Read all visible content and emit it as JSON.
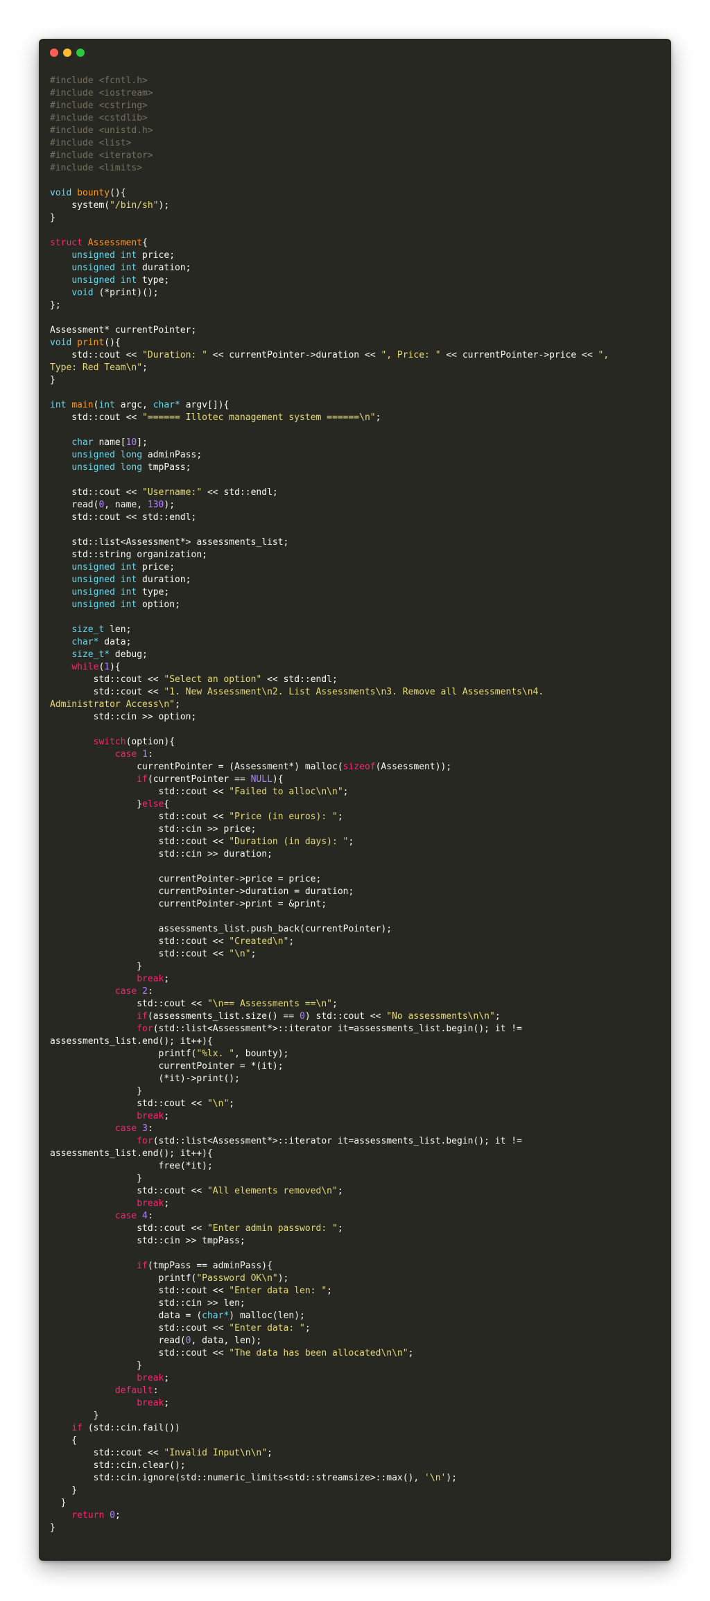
{
  "window": {
    "controls": [
      {
        "name": "close",
        "color": "#ff5f56"
      },
      {
        "name": "minimize",
        "color": "#ffbd2e"
      },
      {
        "name": "maximize",
        "color": "#27c93f"
      }
    ]
  },
  "theme": {
    "background": "#272822",
    "text": "#f8f8f2",
    "comment": "#75715e",
    "keyword": "#f92672",
    "type": "#66d9ef",
    "string": "#e6db74",
    "number": "#ae81ff",
    "name": "#fd971f"
  },
  "code_lines": [
    [
      {
        "t": "#include <fcntl.h>",
        "c": "cm"
      }
    ],
    [
      {
        "t": "#include <iostream>",
        "c": "cm"
      }
    ],
    [
      {
        "t": "#include <cstring>",
        "c": "cm"
      }
    ],
    [
      {
        "t": "#include <cstdlib>",
        "c": "cm"
      }
    ],
    [
      {
        "t": "#include <unistd.h>",
        "c": "cm"
      }
    ],
    [
      {
        "t": "#include <list>",
        "c": "cm"
      }
    ],
    [
      {
        "t": "#include <iterator>",
        "c": "cm"
      }
    ],
    [
      {
        "t": "#include <limits>",
        "c": "cm"
      }
    ],
    [],
    [
      {
        "t": "void",
        "c": "ty"
      },
      {
        "t": " "
      },
      {
        "t": "bounty",
        "c": "df"
      },
      {
        "t": "(){"
      }
    ],
    [
      {
        "t": "    system("
      },
      {
        "t": "\"/bin/sh\"",
        "c": "st"
      },
      {
        "t": ");"
      }
    ],
    [
      {
        "t": "}"
      }
    ],
    [],
    [
      {
        "t": "struct",
        "c": "kw"
      },
      {
        "t": " "
      },
      {
        "t": "Assessment",
        "c": "cl"
      },
      {
        "t": "{"
      }
    ],
    [
      {
        "t": "    "
      },
      {
        "t": "unsigned int",
        "c": "ty"
      },
      {
        "t": " price;"
      }
    ],
    [
      {
        "t": "    "
      },
      {
        "t": "unsigned int",
        "c": "ty"
      },
      {
        "t": " duration;"
      }
    ],
    [
      {
        "t": "    "
      },
      {
        "t": "unsigned int",
        "c": "ty"
      },
      {
        "t": " type;"
      }
    ],
    [
      {
        "t": "    "
      },
      {
        "t": "void",
        "c": "ty"
      },
      {
        "t": " (*print)();"
      }
    ],
    [
      {
        "t": "};"
      }
    ],
    [],
    [
      {
        "t": "Assessment* currentPointer;"
      }
    ],
    [
      {
        "t": "void",
        "c": "ty"
      },
      {
        "t": " "
      },
      {
        "t": "print",
        "c": "df"
      },
      {
        "t": "(){"
      }
    ],
    [
      {
        "t": "    std::cout << "
      },
      {
        "t": "\"Duration: \"",
        "c": "st"
      },
      {
        "t": " << currentPointer->duration << "
      },
      {
        "t": "\", Price: \"",
        "c": "st"
      },
      {
        "t": " << currentPointer->price << "
      },
      {
        "t": "\",",
        "c": "st"
      }
    ],
    [
      {
        "t": "Type: Red Team\\n\"",
        "c": "st"
      },
      {
        "t": ";"
      }
    ],
    [
      {
        "t": "}"
      }
    ],
    [],
    [
      {
        "t": "int",
        "c": "ty"
      },
      {
        "t": " "
      },
      {
        "t": "main",
        "c": "df"
      },
      {
        "t": "("
      },
      {
        "t": "int",
        "c": "ty"
      },
      {
        "t": " argc, "
      },
      {
        "t": "char*",
        "c": "ty"
      },
      {
        "t": " argv[]){"
      }
    ],
    [
      {
        "t": "    std::cout << "
      },
      {
        "t": "\"====== Illotec management system ======\\n\"",
        "c": "st"
      },
      {
        "t": ";"
      }
    ],
    [],
    [
      {
        "t": "    "
      },
      {
        "t": "char",
        "c": "ty"
      },
      {
        "t": " name["
      },
      {
        "t": "10",
        "c": "nu"
      },
      {
        "t": "];"
      }
    ],
    [
      {
        "t": "    "
      },
      {
        "t": "unsigned long",
        "c": "ty"
      },
      {
        "t": " adminPass;"
      }
    ],
    [
      {
        "t": "    "
      },
      {
        "t": "unsigned long",
        "c": "ty"
      },
      {
        "t": " tmpPass;"
      }
    ],
    [],
    [
      {
        "t": "    std::cout << "
      },
      {
        "t": "\"Username:\"",
        "c": "st"
      },
      {
        "t": " << std::endl;"
      }
    ],
    [
      {
        "t": "    read("
      },
      {
        "t": "0",
        "c": "nu"
      },
      {
        "t": ", name, "
      },
      {
        "t": "130",
        "c": "nu"
      },
      {
        "t": ");"
      }
    ],
    [
      {
        "t": "    std::cout << std::endl;"
      }
    ],
    [],
    [
      {
        "t": "    std::list<Assessment*> assessments_list;"
      }
    ],
    [
      {
        "t": "    std::string organization;"
      }
    ],
    [
      {
        "t": "    "
      },
      {
        "t": "unsigned int",
        "c": "ty"
      },
      {
        "t": " price;"
      }
    ],
    [
      {
        "t": "    "
      },
      {
        "t": "unsigned int",
        "c": "ty"
      },
      {
        "t": " duration;"
      }
    ],
    [
      {
        "t": "    "
      },
      {
        "t": "unsigned int",
        "c": "ty"
      },
      {
        "t": " type;"
      }
    ],
    [
      {
        "t": "    "
      },
      {
        "t": "unsigned int",
        "c": "ty"
      },
      {
        "t": " option;"
      }
    ],
    [],
    [
      {
        "t": "    "
      },
      {
        "t": "size_t",
        "c": "ty"
      },
      {
        "t": " len;"
      }
    ],
    [
      {
        "t": "    "
      },
      {
        "t": "char*",
        "c": "ty"
      },
      {
        "t": " data;"
      }
    ],
    [
      {
        "t": "    "
      },
      {
        "t": "size_t*",
        "c": "ty"
      },
      {
        "t": " debug;"
      }
    ],
    [
      {
        "t": "    "
      },
      {
        "t": "while",
        "c": "kw"
      },
      {
        "t": "("
      },
      {
        "t": "1",
        "c": "nu"
      },
      {
        "t": "){"
      }
    ],
    [
      {
        "t": "        std::cout << "
      },
      {
        "t": "\"Select an option\"",
        "c": "st"
      },
      {
        "t": " << std::endl;"
      }
    ],
    [
      {
        "t": "        std::cout << "
      },
      {
        "t": "\"1. New Assessment\\n2. List Assessments\\n3. Remove all Assessments\\n4.",
        "c": "st"
      }
    ],
    [
      {
        "t": "Administrator Access\\n\"",
        "c": "st"
      },
      {
        "t": ";"
      }
    ],
    [
      {
        "t": "        std::cin >> option;"
      }
    ],
    [],
    [
      {
        "t": "        "
      },
      {
        "t": "switch",
        "c": "kw"
      },
      {
        "t": "(option){"
      }
    ],
    [
      {
        "t": "            "
      },
      {
        "t": "case",
        "c": "kw"
      },
      {
        "t": " "
      },
      {
        "t": "1",
        "c": "nu"
      },
      {
        "t": ":"
      }
    ],
    [
      {
        "t": "                currentPointer = (Assessment*) malloc("
      },
      {
        "t": "sizeof",
        "c": "kw"
      },
      {
        "t": "(Assessment));"
      }
    ],
    [
      {
        "t": "                "
      },
      {
        "t": "if",
        "c": "kw"
      },
      {
        "t": "(currentPointer == "
      },
      {
        "t": "NULL",
        "c": "nu"
      },
      {
        "t": "){"
      }
    ],
    [
      {
        "t": "                    std::cout << "
      },
      {
        "t": "\"Failed to alloc\\n\\n\"",
        "c": "st"
      },
      {
        "t": ";"
      }
    ],
    [
      {
        "t": "                }"
      },
      {
        "t": "else",
        "c": "kw"
      },
      {
        "t": "{"
      }
    ],
    [
      {
        "t": "                    std::cout << "
      },
      {
        "t": "\"Price (in euros): \"",
        "c": "st"
      },
      {
        "t": ";"
      }
    ],
    [
      {
        "t": "                    std::cin >> price;"
      }
    ],
    [
      {
        "t": "                    std::cout << "
      },
      {
        "t": "\"Duration (in days): \"",
        "c": "st"
      },
      {
        "t": ";"
      }
    ],
    [
      {
        "t": "                    std::cin >> duration;"
      }
    ],
    [],
    [
      {
        "t": "                    currentPointer->price = price;"
      }
    ],
    [
      {
        "t": "                    currentPointer->duration = duration;"
      }
    ],
    [
      {
        "t": "                    currentPointer->print = &print;"
      }
    ],
    [],
    [
      {
        "t": "                    assessments_list.push_back(currentPointer);"
      }
    ],
    [
      {
        "t": "                    std::cout << "
      },
      {
        "t": "\"Created\\n\"",
        "c": "st"
      },
      {
        "t": ";"
      }
    ],
    [
      {
        "t": "                    std::cout << "
      },
      {
        "t": "\"\\n\"",
        "c": "st"
      },
      {
        "t": ";"
      }
    ],
    [
      {
        "t": "                }"
      }
    ],
    [
      {
        "t": "                "
      },
      {
        "t": "break",
        "c": "kw"
      },
      {
        "t": ";"
      }
    ],
    [
      {
        "t": "            "
      },
      {
        "t": "case",
        "c": "kw"
      },
      {
        "t": " "
      },
      {
        "t": "2",
        "c": "nu"
      },
      {
        "t": ":"
      }
    ],
    [
      {
        "t": "                std::cout << "
      },
      {
        "t": "\"\\n== Assessments ==\\n\"",
        "c": "st"
      },
      {
        "t": ";"
      }
    ],
    [
      {
        "t": "                "
      },
      {
        "t": "if",
        "c": "kw"
      },
      {
        "t": "(assessments_list.size() == "
      },
      {
        "t": "0",
        "c": "nu"
      },
      {
        "t": ") std::cout << "
      },
      {
        "t": "\"No assessments\\n\\n\"",
        "c": "st"
      },
      {
        "t": ";"
      }
    ],
    [
      {
        "t": "                "
      },
      {
        "t": "for",
        "c": "kw"
      },
      {
        "t": "(std::list<Assessment*>::iterator it=assessments_list.begin(); it !="
      }
    ],
    [
      {
        "t": "assessments_list.end(); it++){"
      }
    ],
    [
      {
        "t": "                    printf("
      },
      {
        "t": "\"%lx. \"",
        "c": "st"
      },
      {
        "t": ", bounty);"
      }
    ],
    [
      {
        "t": "                    currentPointer = *(it);"
      }
    ],
    [
      {
        "t": "                    (*it)->print();"
      }
    ],
    [
      {
        "t": "                }"
      }
    ],
    [
      {
        "t": "                std::cout << "
      },
      {
        "t": "\"\\n\"",
        "c": "st"
      },
      {
        "t": ";"
      }
    ],
    [
      {
        "t": "                "
      },
      {
        "t": "break",
        "c": "kw"
      },
      {
        "t": ";"
      }
    ],
    [
      {
        "t": "            "
      },
      {
        "t": "case",
        "c": "kw"
      },
      {
        "t": " "
      },
      {
        "t": "3",
        "c": "nu"
      },
      {
        "t": ":"
      }
    ],
    [
      {
        "t": "                "
      },
      {
        "t": "for",
        "c": "kw"
      },
      {
        "t": "(std::list<Assessment*>::iterator it=assessments_list.begin(); it !="
      }
    ],
    [
      {
        "t": "assessments_list.end(); it++){"
      }
    ],
    [
      {
        "t": "                    free(*it);"
      }
    ],
    [
      {
        "t": "                }"
      }
    ],
    [
      {
        "t": "                std::cout << "
      },
      {
        "t": "\"All elements removed\\n\"",
        "c": "st"
      },
      {
        "t": ";"
      }
    ],
    [
      {
        "t": "                "
      },
      {
        "t": "break",
        "c": "kw"
      },
      {
        "t": ";"
      }
    ],
    [
      {
        "t": "            "
      },
      {
        "t": "case",
        "c": "kw"
      },
      {
        "t": " "
      },
      {
        "t": "4",
        "c": "nu"
      },
      {
        "t": ":"
      }
    ],
    [
      {
        "t": "                std::cout << "
      },
      {
        "t": "\"Enter admin password: \"",
        "c": "st"
      },
      {
        "t": ";"
      }
    ],
    [
      {
        "t": "                std::cin >> tmpPass;"
      }
    ],
    [],
    [
      {
        "t": "                "
      },
      {
        "t": "if",
        "c": "kw"
      },
      {
        "t": "(tmpPass == adminPass){"
      }
    ],
    [
      {
        "t": "                    printf("
      },
      {
        "t": "\"Password OK\\n\"",
        "c": "st"
      },
      {
        "t": ");"
      }
    ],
    [
      {
        "t": "                    std::cout << "
      },
      {
        "t": "\"Enter data len: \"",
        "c": "st"
      },
      {
        "t": ";"
      }
    ],
    [
      {
        "t": "                    std::cin >> len;"
      }
    ],
    [
      {
        "t": "                    data = ("
      },
      {
        "t": "char*",
        "c": "ty"
      },
      {
        "t": ") malloc(len);"
      }
    ],
    [
      {
        "t": "                    std::cout << "
      },
      {
        "t": "\"Enter data: \"",
        "c": "st"
      },
      {
        "t": ";"
      }
    ],
    [
      {
        "t": "                    read("
      },
      {
        "t": "0",
        "c": "nu"
      },
      {
        "t": ", data, len);"
      }
    ],
    [
      {
        "t": "                    std::cout << "
      },
      {
        "t": "\"The data has been allocated\\n\\n\"",
        "c": "st"
      },
      {
        "t": ";"
      }
    ],
    [
      {
        "t": "                }"
      }
    ],
    [
      {
        "t": "                "
      },
      {
        "t": "break",
        "c": "kw"
      },
      {
        "t": ";"
      }
    ],
    [
      {
        "t": "            "
      },
      {
        "t": "default",
        "c": "kw"
      },
      {
        "t": ":"
      }
    ],
    [
      {
        "t": "                "
      },
      {
        "t": "break",
        "c": "kw"
      },
      {
        "t": ";"
      }
    ],
    [
      {
        "t": "        }"
      }
    ],
    [
      {
        "t": "    "
      },
      {
        "t": "if",
        "c": "kw"
      },
      {
        "t": " (std::cin.fail())"
      }
    ],
    [
      {
        "t": "    {"
      }
    ],
    [
      {
        "t": "        std::cout << "
      },
      {
        "t": "\"Invalid Input\\n\\n\"",
        "c": "st"
      },
      {
        "t": ";"
      }
    ],
    [
      {
        "t": "        std::cin.clear();"
      }
    ],
    [
      {
        "t": "        std::cin.ignore(std::numeric_limits<std::streamsize>::max(), "
      },
      {
        "t": "'\\n'",
        "c": "st"
      },
      {
        "t": ");"
      }
    ],
    [
      {
        "t": "    }"
      }
    ],
    [
      {
        "t": "  }"
      }
    ],
    [
      {
        "t": "    "
      },
      {
        "t": "return",
        "c": "kw"
      },
      {
        "t": " "
      },
      {
        "t": "0",
        "c": "nu"
      },
      {
        "t": ";"
      }
    ],
    [
      {
        "t": "}"
      }
    ]
  ]
}
